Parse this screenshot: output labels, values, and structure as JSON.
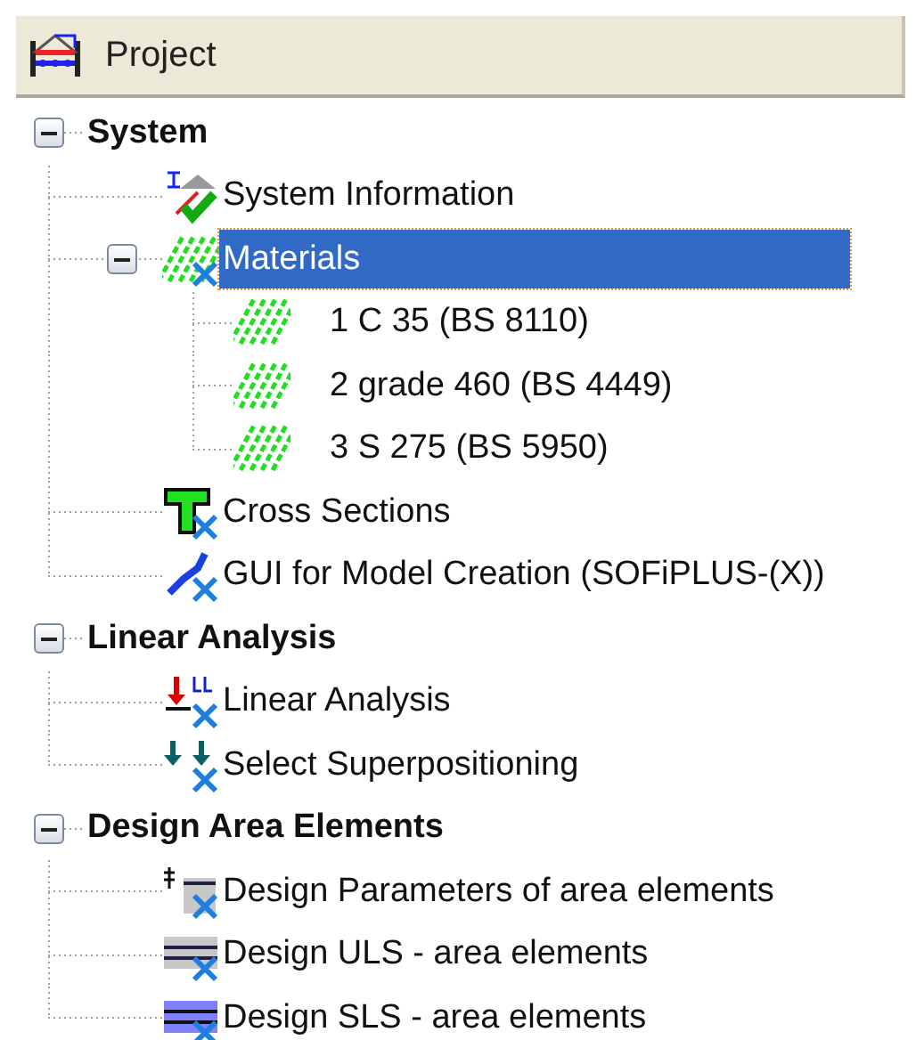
{
  "header": {
    "title": "Project"
  },
  "tree": [
    {
      "label": "System",
      "kind": "group",
      "expanded": true,
      "selected": false,
      "children": [
        {
          "label": "System Information",
          "kind": "system-info",
          "selected": false
        },
        {
          "label": "Materials",
          "kind": "materials",
          "expanded": true,
          "selected": true,
          "children": [
            {
              "label": "1 C 35 (BS 8110)",
              "kind": "material",
              "selected": false
            },
            {
              "label": "2 grade 460 (BS 4449)",
              "kind": "material",
              "selected": false
            },
            {
              "label": "3 S 275 (BS 5950)",
              "kind": "material",
              "selected": false
            }
          ]
        },
        {
          "label": "Cross Sections",
          "kind": "cross-section",
          "selected": false
        },
        {
          "label": "GUI for Model Creation (SOFiPLUS-(X))",
          "kind": "gui",
          "selected": false
        }
      ]
    },
    {
      "label": "Linear Analysis",
      "kind": "group",
      "expanded": true,
      "selected": false,
      "children": [
        {
          "label": "Linear Analysis",
          "kind": "linear-analysis",
          "selected": false
        },
        {
          "label": "Select Superpositioning",
          "kind": "superposition",
          "selected": false
        }
      ]
    },
    {
      "label": "Design Area Elements",
      "kind": "group",
      "expanded": true,
      "selected": false,
      "children": [
        {
          "label": "Design Parameters of area elements",
          "kind": "design-parameters",
          "selected": false
        },
        {
          "label": "Design ULS - area elements",
          "kind": "design-uls",
          "selected": false
        },
        {
          "label": "Design SLS - area elements",
          "kind": "design-sls",
          "selected": false
        }
      ]
    }
  ]
}
